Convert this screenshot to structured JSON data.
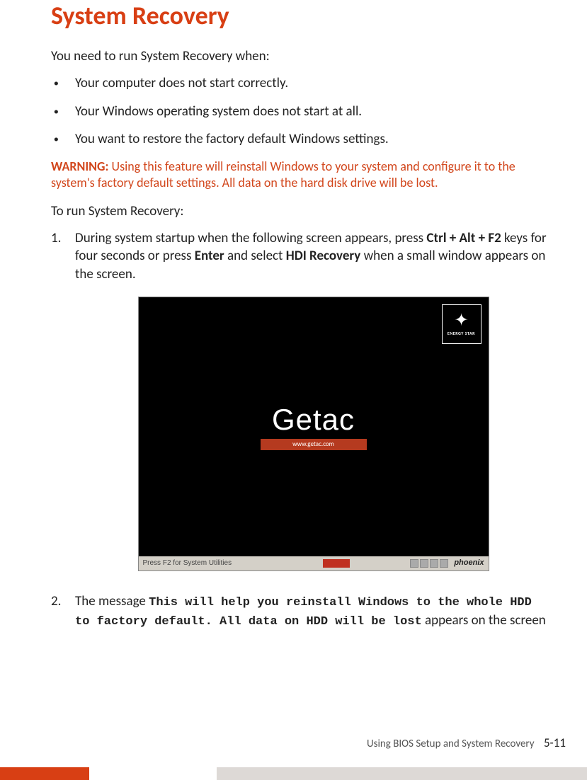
{
  "colors": {
    "accent": "#d83f14",
    "warning": "#d2471d"
  },
  "heading": "System Recovery",
  "intro": "You need to run System Recovery when:",
  "bullets": [
    "Your computer does not start correctly.",
    "Your Windows operating system does not start at all.",
    "You want to restore the factory default Windows settings."
  ],
  "warning": {
    "label": "WARNING:",
    "text": " Using this feature will reinstall Windows to your system and configure it to the system's factory default settings. All data on the hard disk drive will be lost."
  },
  "sub_intro": "To run System Recovery:",
  "steps": {
    "s1": {
      "num": "1.",
      "p1": "During system startup when the following screen appears, press ",
      "k1": "Ctrl + Alt + F2",
      "p2": " keys for four seconds or press ",
      "k2": "Enter",
      "p3": " and select ",
      "k3": "HDI Recovery",
      "p4": " when a small window appears on the screen."
    },
    "s2": {
      "num": "2.",
      "p1": "The message ",
      "m1": "This will help you reinstall Windows to the whole HDD to factory default. All data on HDD will be lost",
      "p2": " appears on the screen"
    }
  },
  "bios": {
    "energy_star": "ENERGY STAR",
    "logo": "Getac",
    "url": "www.getac.com",
    "bar_left": "Press F2 for System Utilities",
    "bar_brand": "phoenix"
  },
  "footer": {
    "section": "Using BIOS Setup and System Recovery",
    "page": "5-11"
  }
}
